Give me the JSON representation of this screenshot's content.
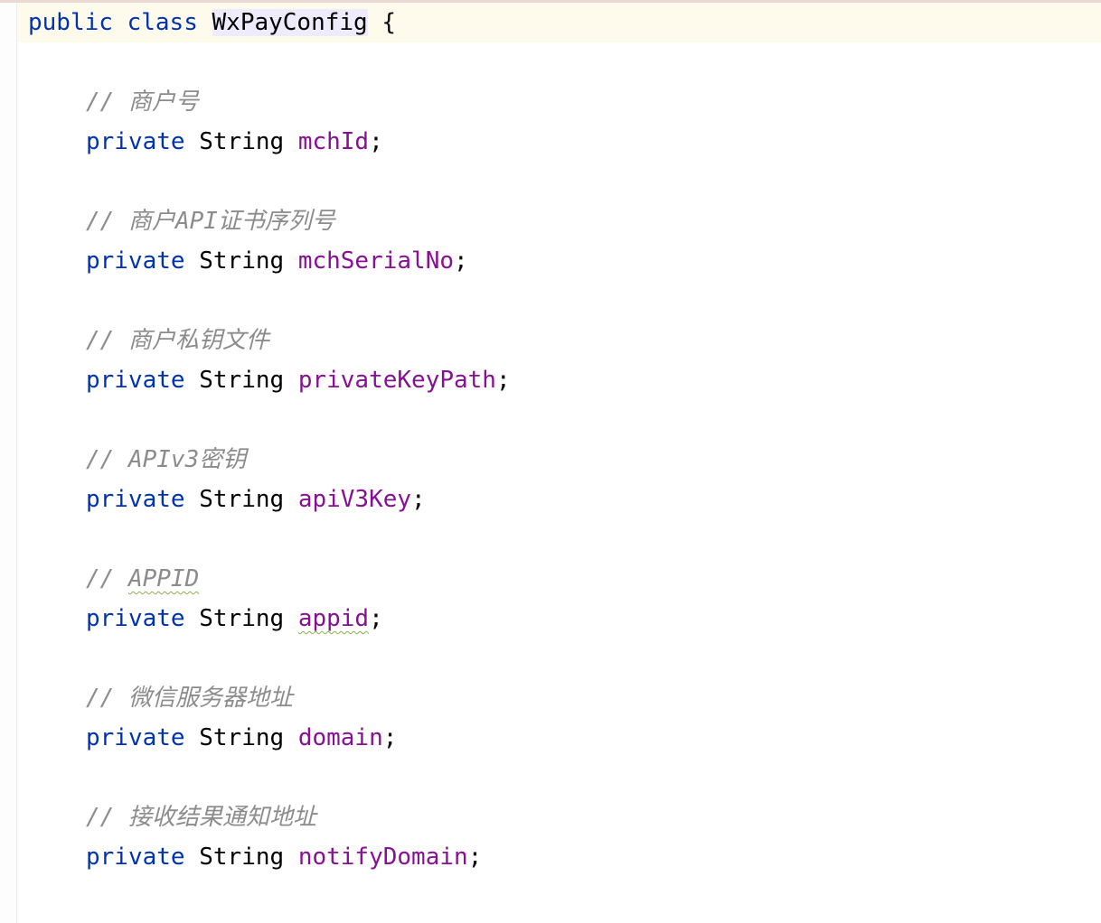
{
  "editor": {
    "declaration": {
      "keyword_public": "public",
      "keyword_class": "class",
      "class_name": "WxPayConfig",
      "open_brace": "{"
    },
    "fields": [
      {
        "comment": "// 商户号",
        "modifier": "private",
        "type": "String",
        "name": "mchId",
        "semicolon": ";"
      },
      {
        "comment": "// 商户API证书序列号",
        "modifier": "private",
        "type": "String",
        "name": "mchSerialNo",
        "semicolon": ";"
      },
      {
        "comment": "// 商户私钥文件",
        "modifier": "private",
        "type": "String",
        "name": "privateKeyPath",
        "semicolon": ";"
      },
      {
        "comment": "// APIv3密钥",
        "modifier": "private",
        "type": "String",
        "name": "apiV3Key",
        "semicolon": ";"
      },
      {
        "comment_prefix": "// ",
        "comment_word": "APPID",
        "modifier": "private",
        "type": "String",
        "name": "appid",
        "semicolon": ";"
      },
      {
        "comment": "// 微信服务器地址",
        "modifier": "private",
        "type": "String",
        "name": "domain",
        "semicolon": ";"
      },
      {
        "comment": "// 接收结果通知地址",
        "modifier": "private",
        "type": "String",
        "name": "notifyDomain",
        "semicolon": ";"
      }
    ],
    "colors": {
      "keyword": "#0033b3",
      "field": "#871094",
      "comment": "#8c8c8c",
      "current_line": "#fefaec",
      "class_highlight": "#edebfc",
      "typo_underline": "#8bb04a"
    }
  }
}
